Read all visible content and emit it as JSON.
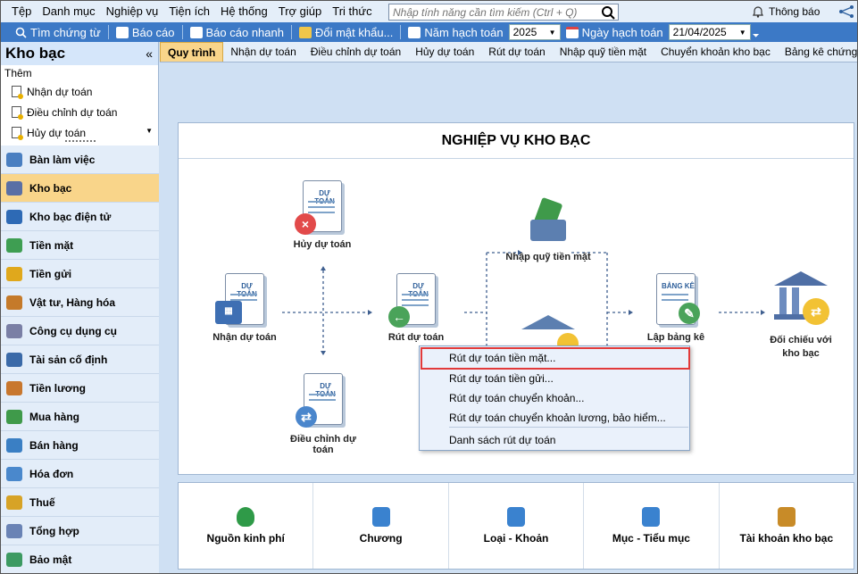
{
  "menu": [
    "Tệp",
    "Danh mục",
    "Nghiệp vụ",
    "Tiện ích",
    "Hệ thống",
    "Trợ giúp",
    "Tri thức"
  ],
  "search": {
    "placeholder": "Nhập tính năng cần tìm kiếm (Ctrl + Q)"
  },
  "notification": "Thông báo",
  "toolbar": {
    "find_voucher": "Tìm chứng từ",
    "report": "Báo cáo",
    "quick_report": "Báo cáo nhanh",
    "change_password": "Đổi mật khẩu...",
    "fiscal_year_label": "Năm hạch toán",
    "fiscal_year_value": "2025",
    "posting_date_label": "Ngày hạch toán",
    "posting_date_value": "21/04/2025"
  },
  "sidebar": {
    "title": "Kho bạc",
    "add_label": "Thêm",
    "add_items": [
      "Nhận dự toán",
      "Điều chỉnh dự toán",
      "Hủy dự toán"
    ],
    "modules": [
      "Bàn làm việc",
      "Kho bạc",
      "Kho bạc điện tử",
      "Tiền mặt",
      "Tiền gửi",
      "Vật tư, Hàng hóa",
      "Công cụ dụng cụ",
      "Tài sản cố định",
      "Tiền lương",
      "Mua hàng",
      "Bán hàng",
      "Hóa đơn",
      "Thuế",
      "Tổng hợp",
      "Bảo mật"
    ],
    "active_module": "Kho bạc"
  },
  "tabs": [
    "Quy trình",
    "Nhận dự toán",
    "Điều chỉnh dự toán",
    "Hủy dự toán",
    "Rút dự toán",
    "Nhập quỹ tiền mặt",
    "Chuyển khoản kho bạc",
    "Bảng kê chứng từ thanh toán"
  ],
  "process": {
    "title": "NGHIỆP VỤ KHO BẠC",
    "doc_label": "DỰ TOÁN",
    "list_label": "BẢNG KÊ",
    "nodes": {
      "cancel": "Hủy dự toán",
      "receive": "Nhận dự toán",
      "withdraw": "Rút dự toán",
      "adjust": "Điều chỉnh dự toán",
      "cash_in": "Nhập quỹ tiền mặt",
      "list": "Lập bảng kê",
      "reconcile": "Đối chiếu với kho bạc"
    }
  },
  "context_menu": [
    "Rút dự toán tiền mặt...",
    "Rút dự toán tiền gửi...",
    "Rút dự toán chuyển khoản...",
    "Rút dự toán chuyển khoản lương, bảo hiểm...",
    "Danh sách rút dự toán"
  ],
  "categories": [
    "Nguồn kinh phí",
    "Chương",
    "Loại - Khoản",
    "Mục - Tiểu mục",
    "Tài khoản kho bạc"
  ],
  "colors": {
    "toolbar_blue": "#3c79c6",
    "active_orange": "#f9d58a",
    "highlight_red": "#e23a3a"
  }
}
